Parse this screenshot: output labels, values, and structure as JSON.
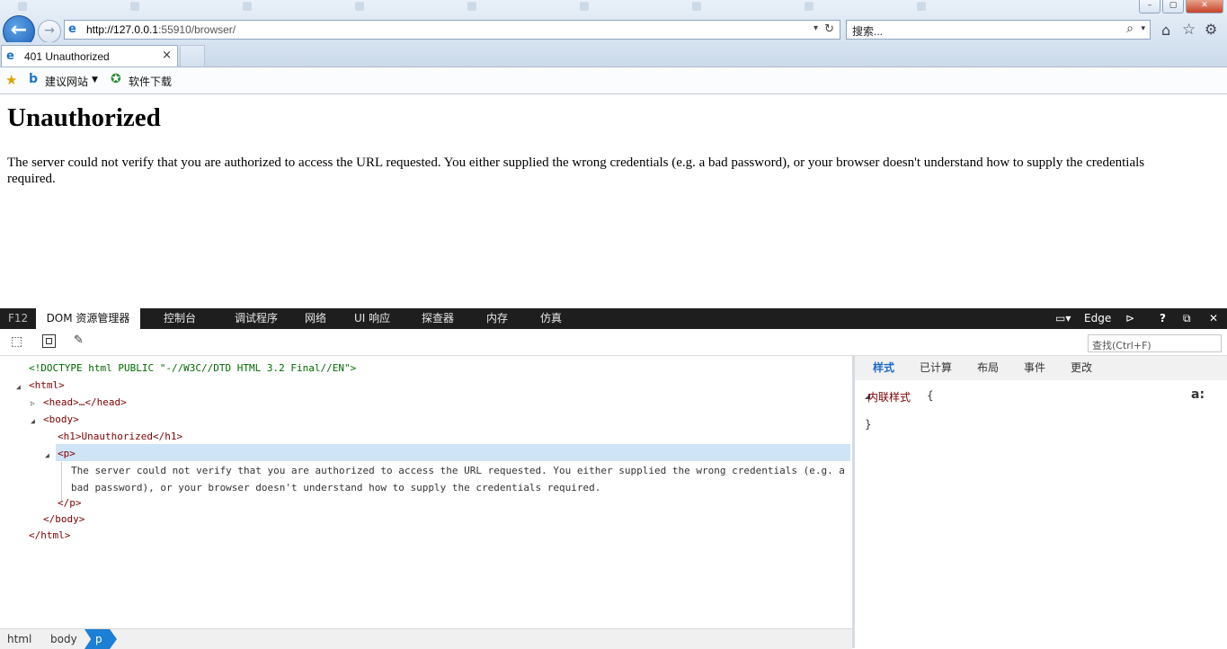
{
  "browser": {
    "window_controls": {
      "minimize": "–",
      "maximize": "▢",
      "close": "✕"
    },
    "address": {
      "host": "http://127.0.0.1",
      "rest": ":55910/browser/"
    },
    "search": {
      "placeholder": "搜索..."
    },
    "tab": {
      "title": "401 Unauthorized",
      "close": "×"
    },
    "favorites": {
      "sites_label": "建议网站",
      "downloads_label": "软件下载"
    }
  },
  "page": {
    "heading": "Unauthorized",
    "paragraph": "The server could not verify that you are authorized to access the URL requested. You either supplied the wrong credentials (e.g. a bad password), or your browser doesn't understand how to supply the credentials required."
  },
  "devtools": {
    "f12": "F12",
    "tabs": [
      "DOM 资源管理器",
      "控制台",
      "调试程序",
      "网络",
      "UI 响应",
      "探查器",
      "内存",
      "仿真"
    ],
    "mode_label": "Edge",
    "help": "?",
    "find_placeholder": "查找(Ctrl+F)",
    "dom": {
      "doctype": "<!DOCTYPE html PUBLIC \"-//W3C//DTD HTML 3.2 Final//EN\">",
      "html_open": "<html>",
      "head": "<head>…</head>",
      "body_open": "<body>",
      "h1": "<h1>Unauthorized</h1>",
      "p_open": "<p>",
      "p_text": "The server could not verify that you are authorized to access the URL requested. You either supplied the wrong credentials (e.g. a bad password), or your browser doesn't understand how to supply the credentials required.",
      "p_close": "</p>",
      "body_close": "</body>",
      "html_close": "</html>"
    },
    "styles": {
      "tabs": [
        "样式",
        "已计算",
        "布局",
        "事件",
        "更改"
      ],
      "inline_label": "内联样式",
      "open_brace": "{",
      "close_brace": "}",
      "font_icon": "a:"
    },
    "breadcrumb": [
      "html",
      "body",
      "p"
    ]
  },
  "colors": {
    "accent": "#1b7fd6",
    "selection": "#cfe4f7",
    "tag": "#7f0000",
    "doctype": "#006b00"
  }
}
